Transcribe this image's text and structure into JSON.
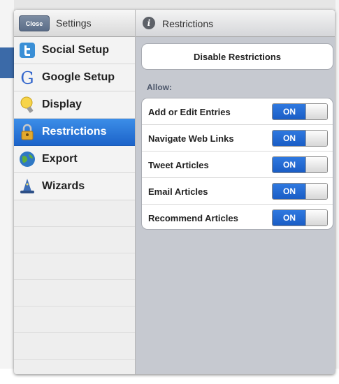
{
  "master": {
    "close_label": "Close",
    "title": "Settings",
    "items": [
      {
        "label": "Social Setup",
        "icon": "twitter-icon",
        "selected": false
      },
      {
        "label": "Google Setup",
        "icon": "google-icon",
        "selected": false
      },
      {
        "label": "Display",
        "icon": "bulb-icon",
        "selected": false
      },
      {
        "label": "Restrictions",
        "icon": "lock-icon",
        "selected": true
      },
      {
        "label": "Export",
        "icon": "globe-icon",
        "selected": false
      },
      {
        "label": "Wizards",
        "icon": "wizard-icon",
        "selected": false
      }
    ]
  },
  "detail": {
    "title": "Restrictions",
    "disable_label": "Disable Restrictions",
    "allow_label": "Allow:",
    "rows": [
      {
        "label": "Add or Edit Entries",
        "state": "ON"
      },
      {
        "label": "Navigate Web Links",
        "state": "ON"
      },
      {
        "label": "Tweet Articles",
        "state": "ON"
      },
      {
        "label": "Email Articles",
        "state": "ON"
      },
      {
        "label": "Recommend Articles",
        "state": "ON"
      }
    ]
  },
  "colors": {
    "accent": "#1c63c9",
    "toggle_on": "#2f79e0"
  }
}
